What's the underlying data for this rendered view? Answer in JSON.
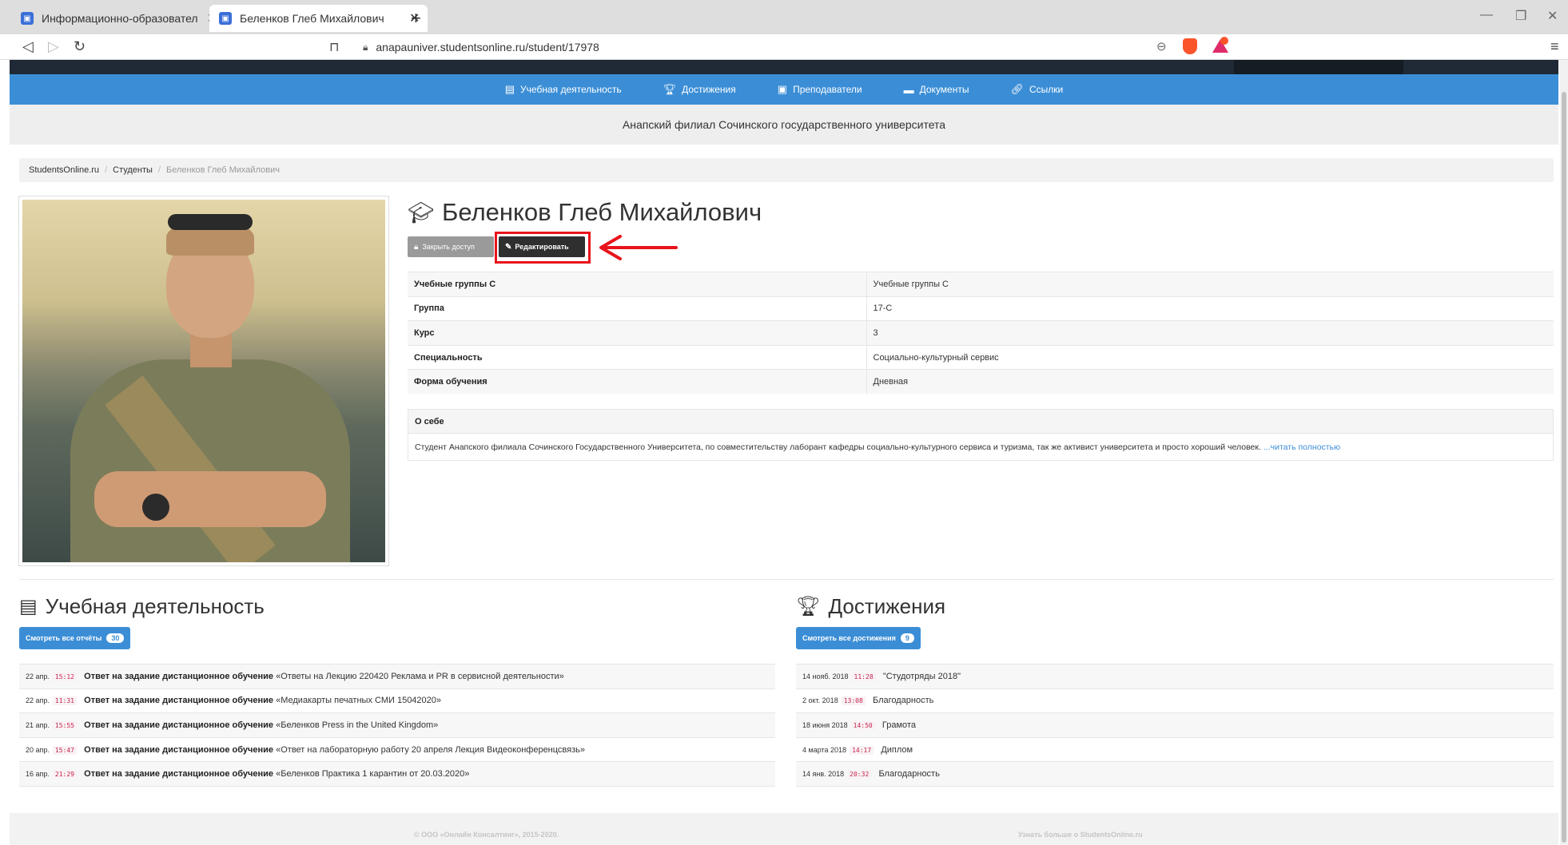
{
  "browser": {
    "tabs": [
      {
        "title": "Информационно-образовательн"
      },
      {
        "title": "Беленков Глеб Михайлович"
      }
    ],
    "url": "anapauniver.studentsonline.ru/student/17978"
  },
  "nav": {
    "items": [
      {
        "label": "Учебная деятельность",
        "icon": "book-icon"
      },
      {
        "label": "Достижения",
        "icon": "trophy-icon"
      },
      {
        "label": "Преподаватели",
        "icon": "teacher-icon"
      },
      {
        "label": "Документы",
        "icon": "folder-icon"
      },
      {
        "label": "Ссылки",
        "icon": "link-icon"
      }
    ]
  },
  "branch": "Анапский филиал Сочинского государственного университета",
  "breadcrumb": {
    "home": "StudentsOnline.ru",
    "students": "Студенты",
    "current": "Беленков Глеб Михайлович"
  },
  "profile": {
    "name": "Беленков Глеб Михайлович",
    "lock_label": "Закрыть доступ",
    "edit_label": "Редактировать",
    "fields": [
      {
        "key": "Учебные группы С",
        "value": "Учебные группы С"
      },
      {
        "key": "Группа",
        "value": "17-С"
      },
      {
        "key": "Курс",
        "value": "3"
      },
      {
        "key": "Специальность",
        "value": "Социально-культурный сервис"
      },
      {
        "key": "Форма обучения",
        "value": "Дневная"
      }
    ],
    "about_title": "О себе",
    "about_text": "Студент Анапского филиала Сочинского Государственного Университета, по совместительству лаборант кафедры социально-культурного сервиса и туризма, так же активист университета и просто хороший человек.",
    "about_more": "...читать полностью"
  },
  "activity": {
    "title": "Учебная деятельность",
    "button_label": "Смотреть все отчёты",
    "count": "30",
    "rows": [
      {
        "date": "22 апр.",
        "time": "15:12",
        "type": "Ответ на задание дистанционное обучение",
        "text": "«Ответы на Лекцию 220420 Реклама и PR в сервисной деятельности»"
      },
      {
        "date": "22 апр.",
        "time": "11:31",
        "type": "Ответ на задание дистанционное обучение",
        "text": "«Медиакарты печатных СМИ 15042020»"
      },
      {
        "date": "21 апр.",
        "time": "15:55",
        "type": "Ответ на задание дистанционное обучение",
        "text": "«Беленков Press in the United Kingdom»"
      },
      {
        "date": "20 апр.",
        "time": "15:47",
        "type": "Ответ на задание дистанционное обучение",
        "text": "«Ответ на лабораторную работу 20 апреля Лекция Видеоконференцсвязь»"
      },
      {
        "date": "16 апр.",
        "time": "21:29",
        "type": "Ответ на задание дистанционное обучение",
        "text": "«Беленков Практика 1 карантин от 20.03.2020»"
      }
    ]
  },
  "achievements": {
    "title": "Достижения",
    "button_label": "Смотреть все достижения",
    "count": "9",
    "rows": [
      {
        "date": "14 нояб. 2018",
        "time": "11:28",
        "text": "\"Студотряды 2018\""
      },
      {
        "date": "2 окт. 2018",
        "time": "13:08",
        "text": "Благодарность"
      },
      {
        "date": "18 июня 2018",
        "time": "14:50",
        "text": "Грамота"
      },
      {
        "date": "4 марта 2018",
        "time": "14:17",
        "text": "Диплом"
      },
      {
        "date": "14 янв. 2018",
        "time": "20:32",
        "text": "Благодарность"
      }
    ]
  },
  "footer": {
    "copyright": "© ООО «Онлайн Консалтинг», 2015-2020.",
    "learn_more": "Узнать больше о StudentsOnline.ru"
  },
  "colors": {
    "nav_blue": "#3b8ed6",
    "highlight_red": "#e8141b",
    "time_pink": "#c7254e"
  }
}
